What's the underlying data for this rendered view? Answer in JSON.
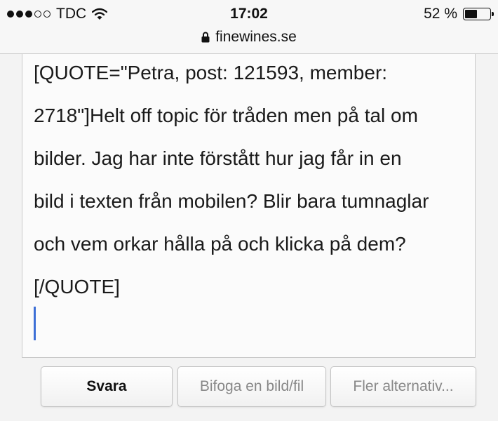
{
  "status_bar": {
    "carrier": "TDC",
    "time": "17:02",
    "battery_percent_label": "52 %",
    "battery_level": 0.52,
    "signal_bars_filled": 3,
    "signal_bars_total": 5,
    "icons": [
      "wifi-icon",
      "battery-icon"
    ]
  },
  "url_bar": {
    "domain": "finewines.se",
    "icon": "lock-icon"
  },
  "editor": {
    "text": "[QUOTE=\"Petra, post: 121593, member:\n2718\"]Helt off topic för tråden men på tal om\nbilder. Jag har inte förstått hur jag får in en\nbild i texten från mobilen? Blir bara tumnaglar\noch vem orkar hålla på och klicka på dem?\n[/QUOTE]"
  },
  "buttons": {
    "reply": "Svara",
    "attach": "Bifoga en bild/fil",
    "more": "Fler alternativ..."
  },
  "colors": {
    "caret": "#3d6fd6",
    "disabled_text": "#888888"
  }
}
